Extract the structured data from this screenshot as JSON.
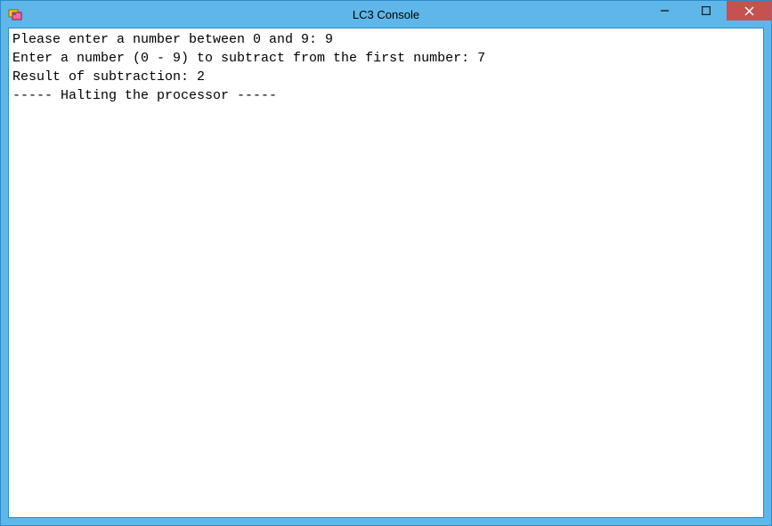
{
  "window": {
    "title": "LC3 Console"
  },
  "console": {
    "line1": "Please enter a number between 0 and 9: 9",
    "blank1": "",
    "line2": "Enter a number (0 - 9) to subtract from the first number: 7",
    "blank2": "",
    "line3": "Result of subtraction: 2",
    "line4": "----- Halting the processor -----"
  }
}
